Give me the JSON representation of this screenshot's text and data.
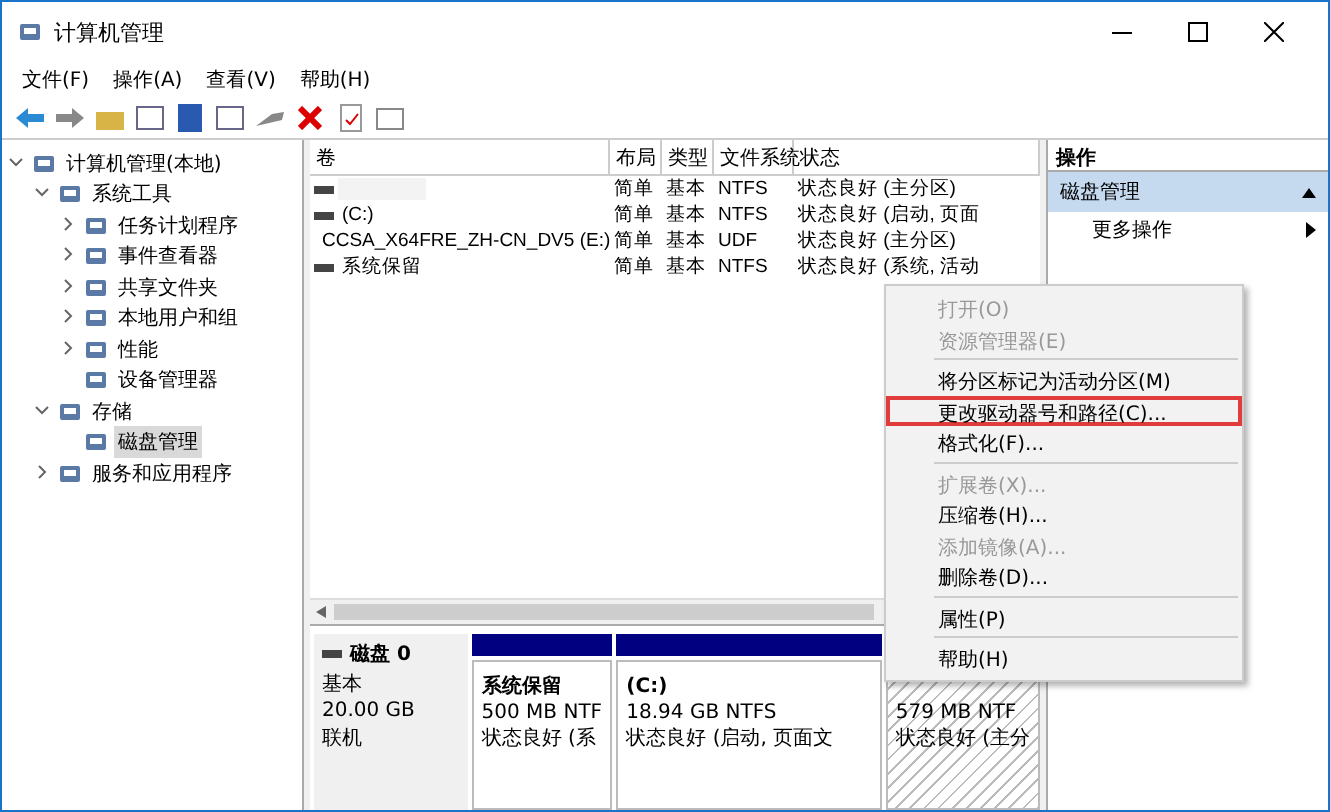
{
  "window": {
    "title": "计算机管理"
  },
  "menu_bar": [
    "文件(F)",
    "操作(A)",
    "查看(V)",
    "帮助(H)"
  ],
  "tree": [
    {
      "label": "计算机管理(本地)",
      "selected": false,
      "expanded": true,
      "children": [
        {
          "label": "系统工具",
          "selected": false,
          "expanded": true,
          "children": [
            {
              "label": "任务计划程序",
              "selected": false,
              "expanded": false,
              "has_children": true
            },
            {
              "label": "事件查看器",
              "selected": false,
              "expanded": false,
              "has_children": true
            },
            {
              "label": "共享文件夹",
              "selected": false,
              "expanded": false,
              "has_children": true
            },
            {
              "label": "本地用户和组",
              "selected": false,
              "expanded": false,
              "has_children": true
            },
            {
              "label": "性能",
              "selected": false,
              "expanded": false,
              "has_children": true
            },
            {
              "label": "设备管理器",
              "selected": false,
              "has_children": false
            }
          ]
        },
        {
          "label": "存储",
          "selected": false,
          "expanded": true,
          "children": [
            {
              "label": "磁盘管理",
              "selected": true,
              "has_children": false
            }
          ]
        },
        {
          "label": "服务和应用程序",
          "selected": false,
          "expanded": false,
          "has_children": true
        }
      ]
    }
  ],
  "volume_table": {
    "columns": [
      "卷",
      "布局",
      "类型",
      "文件系统",
      "状态"
    ],
    "rows": [
      {
        "kind": "disk",
        "layout": "简单",
        "type": "基本",
        "fs": "NTFS",
        "status": "状态良好 (主分区)"
      },
      {
        "kind": "disk",
        "name": "(C:)",
        "layout": "简单",
        "type": "基本",
        "fs": "NTFS",
        "status": "状态良好 (启动, 页面"
      },
      {
        "kind": "cd",
        "name": "CCSA_X64FRE_ZH-CN_DV5 (E:)",
        "layout": "简单",
        "type": "基本",
        "fs": "UDF",
        "status": "状态良好 (主分区)"
      },
      {
        "kind": "disk",
        "name": "系统保留",
        "layout": "简单",
        "type": "基本",
        "fs": "NTFS",
        "status": "状态良好 (系统, 活动"
      }
    ]
  },
  "disk_map": {
    "disk": {
      "name": "磁盘 0",
      "type": "基本",
      "size": "20.00 GB",
      "state": "联机"
    },
    "partitions": [
      {
        "name": "系统保留",
        "size": "500 MB NTF",
        "status": "状态良好 (系",
        "hatched": false
      },
      {
        "name": "(C:)",
        "size": "18.94 GB NTFS",
        "status": "状态良好 (启动, 页面文",
        "hatched": false
      },
      {
        "size": "579 MB NTF",
        "status": "状态良好 (主分",
        "hatched": true
      }
    ]
  },
  "actions": {
    "title": "操作",
    "section": "磁盘管理",
    "items": [
      "更多操作"
    ]
  },
  "context_menu": [
    {
      "kind": "item",
      "label": "打开(O)",
      "disabled": true,
      "highlighted": false
    },
    {
      "kind": "item",
      "label": "资源管理器(E)",
      "disabled": true,
      "highlighted": false
    },
    {
      "kind": "separator"
    },
    {
      "kind": "item",
      "label": "将分区标记为活动分区(M)",
      "disabled": false,
      "highlighted": false
    },
    {
      "kind": "item",
      "label": "更改驱动器号和路径(C)...",
      "disabled": false,
      "highlighted": true
    },
    {
      "kind": "item",
      "label": "格式化(F)...",
      "disabled": false,
      "highlighted": false
    },
    {
      "kind": "separator"
    },
    {
      "kind": "item",
      "label": "扩展卷(X)...",
      "disabled": true,
      "highlighted": false
    },
    {
      "kind": "item",
      "label": "压缩卷(H)...",
      "disabled": false,
      "highlighted": false
    },
    {
      "kind": "item",
      "label": "添加镜像(A)...",
      "disabled": true,
      "highlighted": false
    },
    {
      "kind": "item",
      "label": "删除卷(D)...",
      "disabled": false,
      "highlighted": false
    },
    {
      "kind": "separator"
    },
    {
      "kind": "item",
      "label": "属性(P)",
      "disabled": false,
      "highlighted": false
    },
    {
      "kind": "separator"
    },
    {
      "kind": "item",
      "label": "帮助(H)",
      "disabled": false,
      "highlighted": false
    }
  ]
}
